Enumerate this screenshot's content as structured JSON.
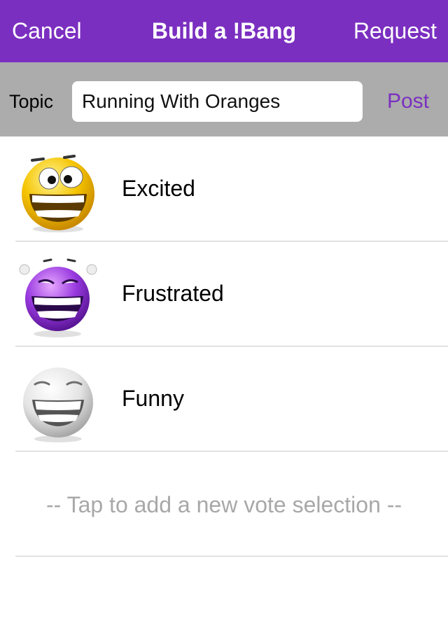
{
  "navbar": {
    "cancel_label": "Cancel",
    "title": "Build a !Bang",
    "request_label": "Request"
  },
  "topic": {
    "label": "Topic",
    "value": "Running With Oranges",
    "post_label": "Post"
  },
  "choices": [
    {
      "label": "Excited",
      "icon": "excited-emoji-icon",
      "color": "#f2c200"
    },
    {
      "label": "Frustrated",
      "icon": "frustrated-emoji-icon",
      "color": "#8a2bd0"
    },
    {
      "label": "Funny",
      "icon": "funny-emoji-icon",
      "color": "#e8e8e8"
    }
  ],
  "add_selection_label": "-- Tap to add a new vote selection --",
  "colors": {
    "accent": "#7b2fc0",
    "topic_bar": "#acacac",
    "placeholder": "#a8a8a8"
  }
}
